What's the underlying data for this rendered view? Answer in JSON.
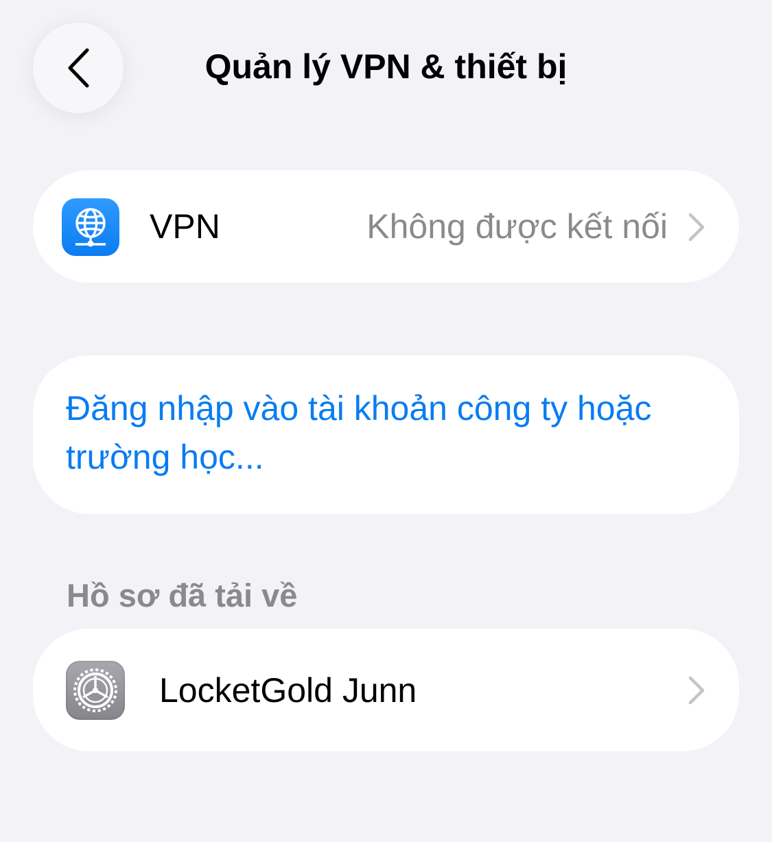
{
  "nav": {
    "title": "Quản lý VPN & thiết bị",
    "back_icon": "chevron-left-icon"
  },
  "vpn_row": {
    "icon": "vpn-globe-icon",
    "label": "VPN",
    "status": "Không được kết nối"
  },
  "signin": {
    "label": "Đăng nhập vào tài khoản công ty hoặc trường học..."
  },
  "profiles_section": {
    "header": "Hồ sơ đã tải về",
    "items": [
      {
        "icon": "settings-gear-icon",
        "label": "LocketGold Junn"
      }
    ]
  },
  "colors": {
    "background": "#f2f2f7",
    "card": "#ffffff",
    "accent": "#0a7cf2",
    "secondary_text": "#8a8a8e"
  }
}
